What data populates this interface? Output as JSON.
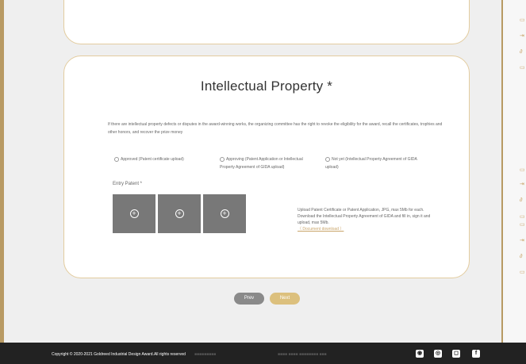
{
  "section": {
    "title": "Intellectual Property *",
    "description": "If there are intellectual property defects or disputes in the award-winning works, the organizing committee has the right to revoke the eligibility for the award, recall the certificates, trophies and other honors, and recover the prize money"
  },
  "options": [
    "Approved (Patent certificate upload)",
    "Approving (Patent Application or Intellectual Property Agreement of GIDA upload)",
    "Not yet (Intellectual Property Agreement of GIDA upload)"
  ],
  "entry": {
    "label": "Entry Patent *",
    "upload_info_1": "Upload Patent Certificate or Patent Application, JPG, max 5Mb for each.",
    "upload_info_2": "Download the Intellectual Property Agreement of GIDA and fill in, sign it and upload, max 5Mb.",
    "download_link": "（ Document download ）"
  },
  "buttons": {
    "prev": "Prev",
    "next": "Next"
  },
  "footer": {
    "copyright": "Copyright © 2020-2021 Goldreed Industrial Design Award.All rights reserved"
  },
  "icons": {
    "upload": "plus-circle-icon",
    "social": [
      "wechat-icon",
      "weibo-icon",
      "instagram-icon",
      "facebook-icon"
    ]
  },
  "colors": {
    "accent": "#dcc07d",
    "frame": "#b89a63",
    "footer": "#222222"
  }
}
